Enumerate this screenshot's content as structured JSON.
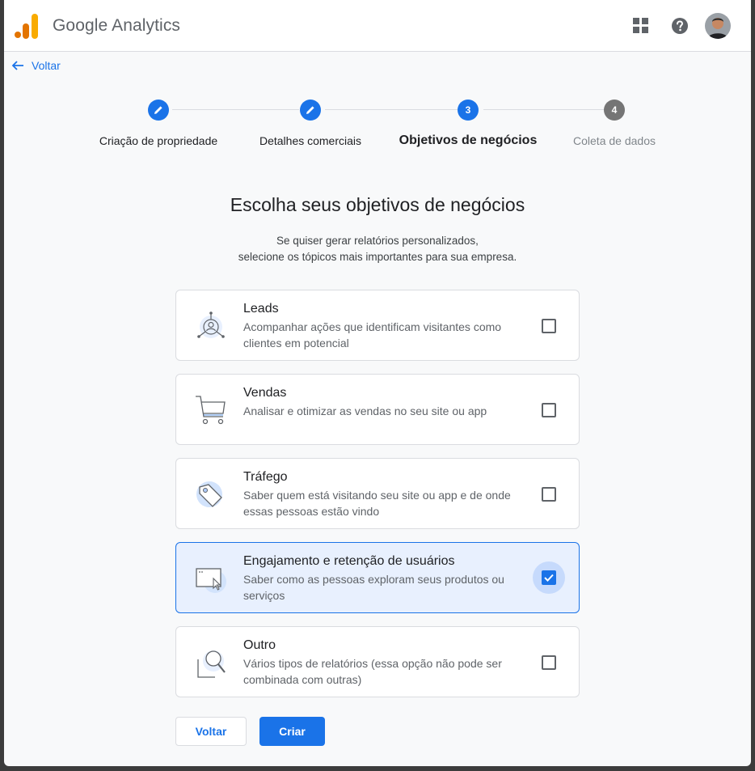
{
  "header": {
    "app_title": "Google Analytics",
    "icons": [
      "analytics-logo",
      "apps-grid-icon",
      "help-icon",
      "avatar"
    ]
  },
  "nav": {
    "back_link": "Voltar"
  },
  "stepper": {
    "steps": [
      {
        "label": "Criação de propriedade",
        "state": "done",
        "marker": "pencil"
      },
      {
        "label": "Detalhes comerciais",
        "state": "done",
        "marker": "pencil"
      },
      {
        "label": "Objetivos de negócios",
        "state": "active",
        "marker": "3"
      },
      {
        "label": "Coleta de dados",
        "state": "pending",
        "marker": "4"
      }
    ]
  },
  "main": {
    "heading": "Escolha seus objetivos de negócios",
    "subheading_line1": "Se quiser gerar relatórios personalizados,",
    "subheading_line2": "selecione os tópicos mais importantes para sua empresa.",
    "options": [
      {
        "title": "Leads",
        "description": "Acompanhar ações que identificam visitantes como clientes em potencial",
        "checked": false,
        "icon": "leads-icon"
      },
      {
        "title": "Vendas",
        "description": "Analisar e otimizar as vendas no seu site ou app",
        "checked": false,
        "icon": "shopping-cart-icon"
      },
      {
        "title": "Tráfego",
        "description": "Saber quem está visitando seu site ou app e de onde essas pessoas estão vindo",
        "checked": false,
        "icon": "tag-icon"
      },
      {
        "title": "Engajamento e retenção de usuários",
        "description": "Saber como as pessoas exploram seus produtos ou serviços",
        "checked": true,
        "icon": "browser-cursor-icon"
      },
      {
        "title": "Outro",
        "description": "Vários tipos de relatórios (essa opção não pode ser combinada com outras)",
        "checked": false,
        "icon": "magnifier-icon"
      }
    ]
  },
  "footer": {
    "back_button": "Voltar",
    "create_button": "Criar"
  },
  "colors": {
    "primary": "#1a73e8",
    "selected_bg": "#e8f0fe",
    "logo_orange": "#f9ab00",
    "logo_dark_orange": "#e37400"
  }
}
